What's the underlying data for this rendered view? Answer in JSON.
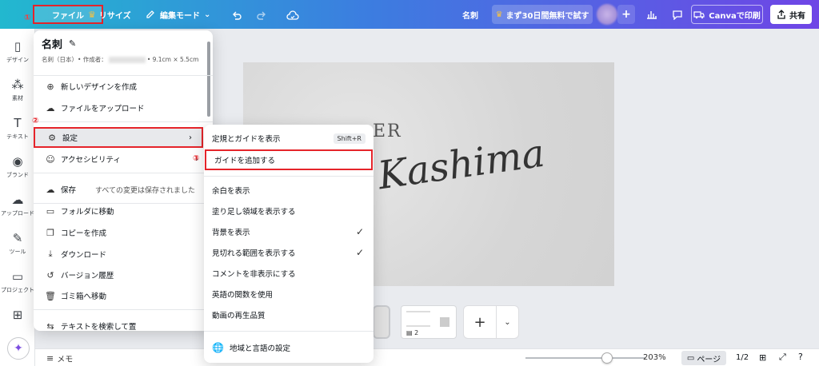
{
  "topbar": {
    "file_label": "ファイル",
    "step1": "①",
    "resize_label": "リサイズ",
    "editmode_label": "編集モード",
    "doc_name": "名刺",
    "trial_label": "まず30日間無料で試す",
    "print_label": "Canvaで印刷",
    "share_label": "共有"
  },
  "rail": [
    {
      "icon": "design-icon",
      "label": "デザイン"
    },
    {
      "icon": "elements-icon",
      "label": "素材"
    },
    {
      "icon": "text-icon",
      "label": "テキスト"
    },
    {
      "icon": "brand-icon",
      "label": "ブランド"
    },
    {
      "icon": "upload-icon",
      "label": "アップロード"
    },
    {
      "icon": "tools-icon",
      "label": "ツール"
    },
    {
      "icon": "projects-icon",
      "label": "プロジェクト"
    },
    {
      "icon": "apps-icon",
      "label": ""
    }
  ],
  "file_menu": {
    "title": "名刺",
    "subtitle_left": "名刺（日本）• 作成者：",
    "subtitle_right": "• 9.1cm × 5.5cm",
    "items": [
      {
        "label": "新しいデザインを作成",
        "icon": "new-design-icon"
      },
      {
        "label": "ファイルをアップロード",
        "icon": "upload-icon"
      },
      {
        "label": "設定",
        "icon": "gear-icon"
      },
      {
        "label": "アクセシビリティ",
        "icon": "accessibility-icon"
      },
      {
        "label": "保存",
        "icon": "cloud-icon",
        "sub": "すべての変更は保存されました"
      },
      {
        "label": "フォルダに移動",
        "icon": "folder-icon"
      },
      {
        "label": "コピーを作成",
        "icon": "copy-icon"
      },
      {
        "label": "ダウンロード",
        "icon": "download-icon"
      },
      {
        "label": "バージョン履歴",
        "icon": "history-icon"
      },
      {
        "label": "ゴミ箱へ移動",
        "icon": "trash-icon"
      },
      {
        "label": "テキストを検索して置",
        "icon": "search-replace-icon"
      }
    ],
    "step2": "②"
  },
  "submenu": {
    "step3": "③",
    "items": [
      {
        "label": "定規とガイドを表示",
        "shortcut": "Shift+R"
      },
      {
        "label": "ガイドを追加する"
      },
      {
        "label": "余白を表示"
      },
      {
        "label": "塗り足し領域を表示する"
      },
      {
        "label": "背景を表示",
        "checked": true
      },
      {
        "label": "見切れる範囲を表示する",
        "checked": true
      },
      {
        "label": "コメントを非表示にする"
      },
      {
        "label": "英語の関数を使用"
      },
      {
        "label": "動画の再生品質"
      },
      {
        "label": "地域と言語の設定",
        "icon": "globe-icon"
      }
    ]
  },
  "canvas": {
    "title_text": "ER",
    "script_text": "Kashima"
  },
  "thumbnails": {
    "page_num": "2"
  },
  "bottombar": {
    "memo_label": "メモ",
    "zoom": "203%",
    "page_label": "ページ",
    "page_count": "1/2"
  }
}
